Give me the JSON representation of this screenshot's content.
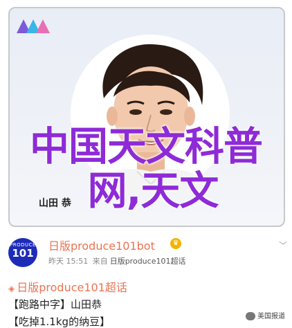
{
  "card": {
    "caption_name": "山田 恭",
    "overlay_line1": "中国天文科普",
    "overlay_line2": "网,天文"
  },
  "post": {
    "avatar_small": "PRODUCE",
    "avatar_big": "101",
    "username": "日版produce101bot",
    "verified_icon": "crown-verified-icon",
    "dropdown_icon": "chevron-down-icon",
    "meta_date": "昨天 15:51",
    "meta_source_prefix": "来自",
    "meta_source": "日版produce101超话",
    "topic": "日版produce101超话",
    "line1": "【跑路中字】山田恭",
    "line2": "【吃掉1.1kg的纳豆】",
    "watermark": "美国报道"
  },
  "colors": {
    "accent": "#eb7350",
    "overlay": "#8e2bd6",
    "avatar_bg": "#1d2bb8"
  }
}
